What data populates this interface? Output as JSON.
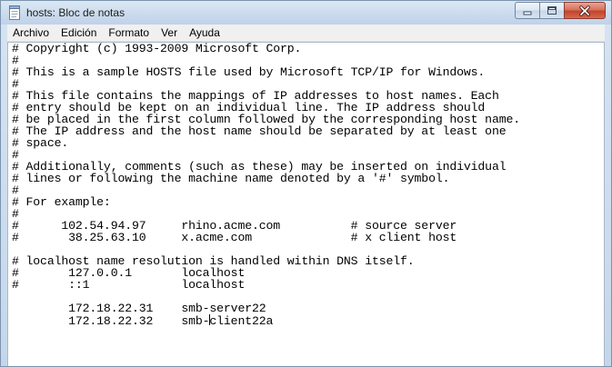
{
  "window": {
    "title": "hosts: Bloc de notas"
  },
  "menu": [
    {
      "id": "archivo",
      "label": "Archivo"
    },
    {
      "id": "edicion",
      "label": "Edición"
    },
    {
      "id": "formato",
      "label": "Formato"
    },
    {
      "id": "ver",
      "label": "Ver"
    },
    {
      "id": "ayuda",
      "label": "Ayuda"
    }
  ],
  "caption_buttons": {
    "minimize_icon": "minimize-icon",
    "maximize_icon": "maximize-icon",
    "close_icon": "close-icon"
  },
  "editor": {
    "caret": {
      "line": 23,
      "column": 28
    },
    "lines": [
      "# Copyright (c) 1993-2009 Microsoft Corp.",
      "#",
      "# This is a sample HOSTS file used by Microsoft TCP/IP for Windows.",
      "#",
      "# This file contains the mappings of IP addresses to host names. Each",
      "# entry should be kept on an individual line. The IP address should",
      "# be placed in the first column followed by the corresponding host name.",
      "# The IP address and the host name should be separated by at least one",
      "# space.",
      "#",
      "# Additionally, comments (such as these) may be inserted on individual",
      "# lines or following the machine name denoted by a '#' symbol.",
      "#",
      "# For example:",
      "#",
      "#      102.54.94.97     rhino.acme.com          # source server",
      "#       38.25.63.10     x.acme.com              # x client host",
      "",
      "# localhost name resolution is handled within DNS itself.",
      "#       127.0.0.1       localhost",
      "#       ::1             localhost",
      "",
      "        172.18.22.31    smb-server22",
      "        172.18.22.32    smb-client22a"
    ]
  }
}
